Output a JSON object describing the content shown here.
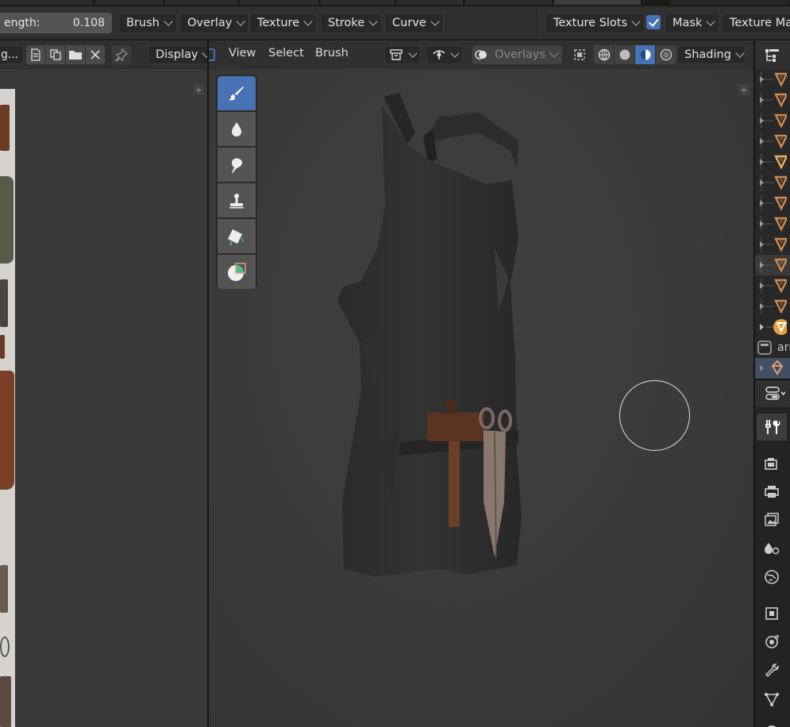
{
  "tool_header": {
    "strength_label": "ength:",
    "strength_value": "0.108",
    "dropdowns": [
      "Brush",
      "Overlay",
      "Texture",
      "Stroke",
      "Curve"
    ],
    "texture_slots": "Texture Slots",
    "mask_checked": true,
    "mask_label": "Mask",
    "texture_mask": "Texture Mas"
  },
  "image_editor": {
    "image_name": "g...",
    "display_label": "Display"
  },
  "viewport": {
    "menus": [
      "View",
      "Select",
      "Brush"
    ],
    "overlays_label": "Overlays",
    "shading_label": "Shading",
    "active_tool": "draw",
    "tools": [
      "draw",
      "soften",
      "smear",
      "clone",
      "fill",
      "mask"
    ],
    "accent_color": "#4772b3"
  },
  "outliner": {
    "partial_item_label": "arı"
  }
}
